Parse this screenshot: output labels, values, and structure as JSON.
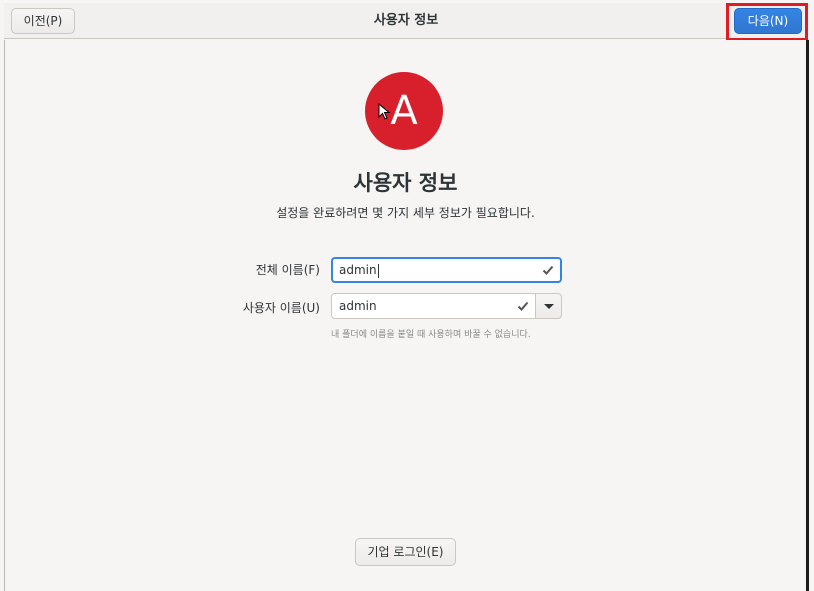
{
  "header": {
    "title": "사용자 정보",
    "back_label": "이전(P)",
    "next_label": "다음(N)"
  },
  "avatar": {
    "initial": "A",
    "color": "#d7202c"
  },
  "main": {
    "title": "사용자 정보",
    "subtitle": "설정을 완료하려면 몇 가지 세부 정보가 필요합니다."
  },
  "form": {
    "fullname_label": "전체 이름(F)",
    "fullname_value": "admin",
    "username_label": "사용자 이름(U)",
    "username_value": "admin",
    "username_hint": "내 폴더에 이름을 붙일 때 사용하며 바꿀 수 없습니다."
  },
  "footer": {
    "enterprise_login_label": "기업 로그인(E)"
  },
  "colors": {
    "accent": "#3584e4",
    "highlight": "#e01b24",
    "background": "#f6f5f4"
  },
  "icons": {
    "fullname_valid": "check-icon",
    "username_valid": "check-icon",
    "username_menu": "chevron-down-icon",
    "pointer": "cursor-icon"
  }
}
